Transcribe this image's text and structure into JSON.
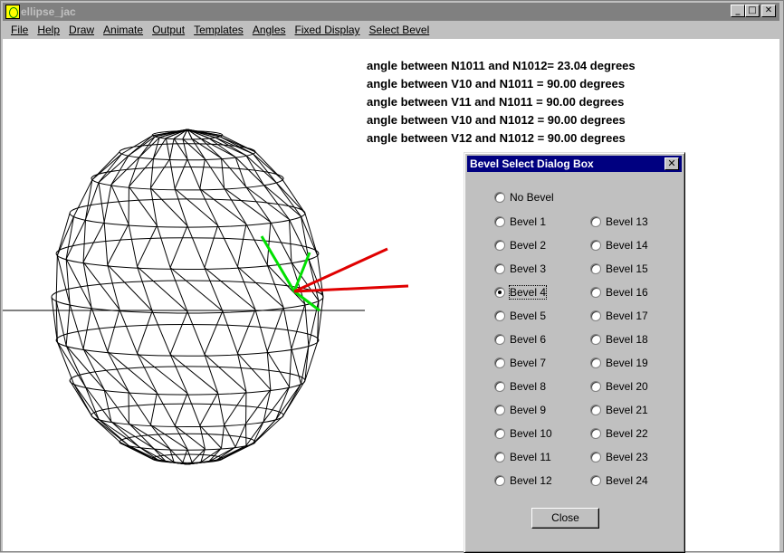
{
  "window": {
    "title": "ellipse_jac",
    "minimize_label": "_",
    "maximize_label": "□",
    "close_label": "✕"
  },
  "menu": [
    "File",
    "Help",
    "Draw",
    "Animate",
    "Output",
    "Templates",
    "Angles",
    "Fixed Display",
    "Select Bevel"
  ],
  "angles": [
    "angle between N1011 and N1012= 23.04 degrees",
    "angle between V10 and N1011 = 90.00 degrees",
    "angle between V11 and N1011 = 90.00 degrees",
    "angle between V10 and N1012 = 90.00 degrees",
    "angle between V12 and N1012 = 90.00 degrees"
  ],
  "dialog": {
    "title": "Bevel Select Dialog Box",
    "close_icon": "✕",
    "no_bevel": "No Bevel",
    "left_options": [
      "Bevel 1",
      "Bevel 2",
      "Bevel 3",
      "Bevel 4",
      "Bevel 5",
      "Bevel 6",
      "Bevel 7",
      "Bevel 8",
      "Bevel 9",
      "Bevel 10",
      "Bevel 11",
      "Bevel 12"
    ],
    "right_options": [
      "Bevel 13",
      "Bevel 14",
      "Bevel 15",
      "Bevel 16",
      "Bevel 17",
      "Bevel 18",
      "Bevel 19",
      "Bevel 20",
      "Bevel 21",
      "Bevel 22",
      "Bevel 23",
      "Bevel 24"
    ],
    "selected": "Bevel 4",
    "close_button": "Close"
  },
  "colors": {
    "vector_green": "#00e000",
    "vector_red": "#e00000",
    "title_inactive": "#808080",
    "dialog_title": "#000080"
  }
}
